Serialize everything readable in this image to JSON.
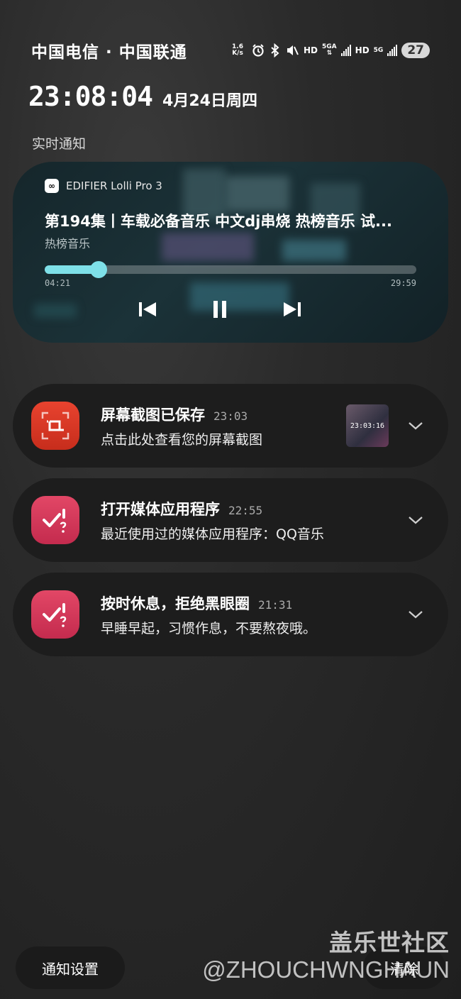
{
  "status_bar": {
    "carrier": "中国电信 · 中国联通",
    "speed_value": "1.6",
    "speed_unit": "K/s",
    "hd1": "HD",
    "net1": "5GA",
    "hd2": "HD",
    "net2": "5G",
    "battery": "27",
    "icons": [
      "data-speed-icon",
      "alarm-icon",
      "bluetooth-icon",
      "mute-icon",
      "signal-icon",
      "signal-icon",
      "battery-icon"
    ]
  },
  "header": {
    "time": "23:08:04",
    "date": "4月24日周四",
    "section_label": "实时通知"
  },
  "media": {
    "app_name": "EDIFIER Lolli Pro 3",
    "title": "第194集丨车载必备音乐 中文dj串烧 热榜音乐 试...",
    "artist": "热榜音乐",
    "elapsed": "04:21",
    "duration": "29:59",
    "progress_fraction": 0.145,
    "accent": "#7ee0e8"
  },
  "notifications": [
    {
      "title": "屏幕截图已保存",
      "time": "23:03",
      "body": "点击此处查看您的屏幕截图",
      "thumb_time": "23:03:16",
      "icon": "screenshot-icon"
    },
    {
      "title": "打开媒体应用程序",
      "time": "22:55",
      "body": "最近使用过的媒体应用程序：QQ音乐",
      "icon": "digital-wellbeing-icon"
    },
    {
      "title": "按时休息，拒绝黑眼圈",
      "time": "21:31",
      "body": "早睡早起，习惯作息，不要熬夜哦。",
      "icon": "digital-wellbeing-icon"
    }
  ],
  "bottom": {
    "settings_label": "通知设置",
    "clear_label": "清除"
  },
  "watermark": {
    "line1": "盖乐世社区",
    "line2": "@ZHOUCHWNGHAUN"
  }
}
